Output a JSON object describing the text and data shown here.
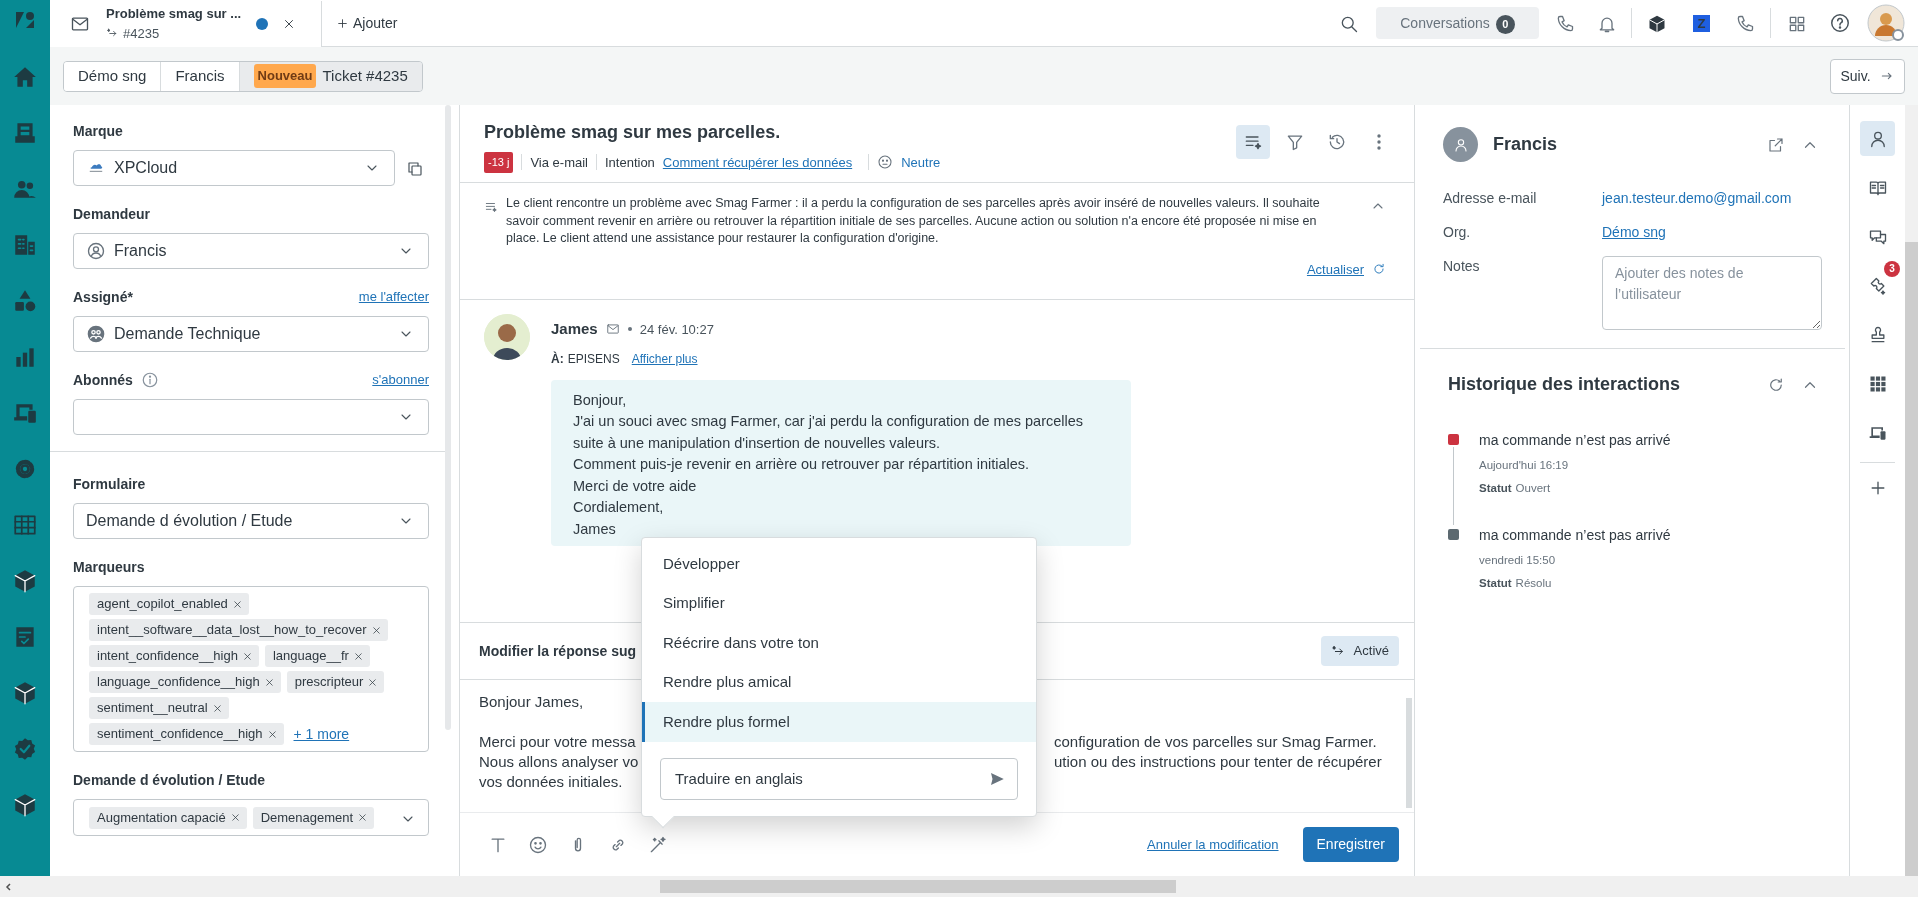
{
  "top_bar": {
    "tab": {
      "title": "Problème smag sur ...",
      "number": "#4235",
      "unsaved": true
    },
    "add": "Ajouter",
    "conversations": {
      "label": "Conversations",
      "count": "0"
    },
    "app_letter": "Z"
  },
  "breadcrumbs": [
    {
      "label": "Démo sng",
      "selected": false
    },
    {
      "label": "Francis",
      "selected": false
    },
    {
      "label": "Ticket #4235",
      "status": "Nouveau",
      "selected": true
    }
  ],
  "next_button": "Suiv.",
  "ticket_fields": [
    [
      {
        "kind": "brand",
        "label": "Marque",
        "value": "XPCloud"
      },
      {
        "kind": "person",
        "label": "Demandeur",
        "value": "Francis"
      },
      {
        "kind": "group",
        "label": "Assigné*",
        "link": "me l'affecter",
        "value": "Demande Technique"
      },
      {
        "kind": "plain",
        "label": "Abonnés",
        "info": true,
        "link": "s'abonner"
      }
    ],
    [
      {
        "kind": "plain",
        "label": "Formulaire",
        "value": "Demande d évolution / Etude"
      },
      {
        "kind": "tags",
        "label": "Marqueurs",
        "tags": [
          "agent_copilot_enabled",
          "intent__software__data_lost__how_to_recover",
          "intent_confidence__high",
          "language__fr",
          "language_confidence__high",
          "prescripteur",
          "sentiment__neutral",
          "sentiment_confidence__high"
        ],
        "more": "+ 1 more"
      },
      {
        "kind": "tags",
        "label": "Demande d évolution / Etude",
        "tags": [
          "Augmentation capacié",
          "Demenagement"
        ],
        "dropdown": true
      }
    ]
  ],
  "ticket": {
    "title": "Problème smag sur mes parcelles.",
    "age": "-13 j",
    "channel": "Via e-mail",
    "intent_label": "Intention",
    "intent": "Comment récupérer les données",
    "sentiment": "Neutre"
  },
  "summary": {
    "text": "Le client rencontre un problème avec Smag Farmer : il a perdu la configuration de ses parcelles après avoir inséré de nouvelles valeurs. Il souhaite savoir comment revenir en arrière ou retrouver la répartition initiale de ses parcelles. Aucune action ou solution n'a encore été proposée ni mise en place. Le client attend une assistance pour restaurer la configuration d'origine.",
    "refresh": "Actualiser"
  },
  "message": {
    "author": "James",
    "time": "24 fév. 10:27",
    "to_label": "À:",
    "to": "EPISENS",
    "show_more": "Afficher plus",
    "lines": [
      "Bonjour,",
      "J'ai un souci avec smag Farmer, car j'ai perdu la configuration de mes parcelles",
      "suite à une manipulation d'insertion de nouvelles valeurs.",
      "Comment puis-je revenir en arrière ou retrouver par répartition initiales.",
      "Merci de votre aide",
      "Cordialement,",
      "James"
    ]
  },
  "reply": {
    "title": "Modifier la réponse sug",
    "toggle": {
      "label": "Activé",
      "on": true
    },
    "paragraphs": [
      [
        {
          "left": "Bonjour James,"
        }
      ],
      [
        {
          "left": "Merci pour votre messa",
          "right": "configuration de vos parcelles sur Smag Farmer."
        },
        {
          "left": "Nous allons analyser vo",
          "right": "ution ou des instructions pour tenter de récupérer"
        },
        {
          "left": "vos données initiales."
        }
      ]
    ],
    "cancel": "Annuler la modification",
    "save": "Enregistrer"
  },
  "ai_menu": {
    "items": [
      {
        "label": "Développer",
        "selected": false
      },
      {
        "label": "Simplifier",
        "selected": false
      },
      {
        "label": "Réécrire dans votre ton",
        "selected": false
      },
      {
        "label": "Rendre plus amical",
        "selected": false
      },
      {
        "label": "Rendre plus formel",
        "selected": true
      }
    ],
    "prompt": {
      "placeholder": "Traduire en anglais"
    }
  },
  "user": {
    "name": "Francis",
    "fields": [
      {
        "kind": "text",
        "label": "Adresse e-mail",
        "value": "jean.testeur.demo@gmail.com"
      },
      {
        "kind": "link",
        "label": "Org.",
        "value": "Démo sng"
      },
      {
        "kind": "textarea",
        "label": "Notes",
        "placeholder": "Ajouter des notes de l’utilisateur"
      }
    ]
  },
  "history": {
    "title": "Historique des interactions",
    "items": [
      {
        "title": "ma commande n’est pas arrivé",
        "time": "Aujourd'hui 16:19",
        "status_label": "Statut",
        "status": "Ouvert",
        "color": "#cc3340"
      },
      {
        "title": "ma commande n’est pas arrivé",
        "time": "vendredi 15:50",
        "status_label": "Statut",
        "status": "Résolu",
        "color": "#5c6970"
      }
    ]
  },
  "right_rail": [
    {
      "kind": "person",
      "selected": true
    },
    {
      "kind": "book",
      "selected": false
    },
    {
      "kind": "chat",
      "selected": false
    },
    {
      "kind": "ticket",
      "selected": false,
      "badge": "3"
    },
    {
      "kind": "stamp",
      "selected": false
    },
    {
      "kind": "apps",
      "selected": false
    },
    {
      "kind": "device",
      "selected": false
    }
  ]
}
